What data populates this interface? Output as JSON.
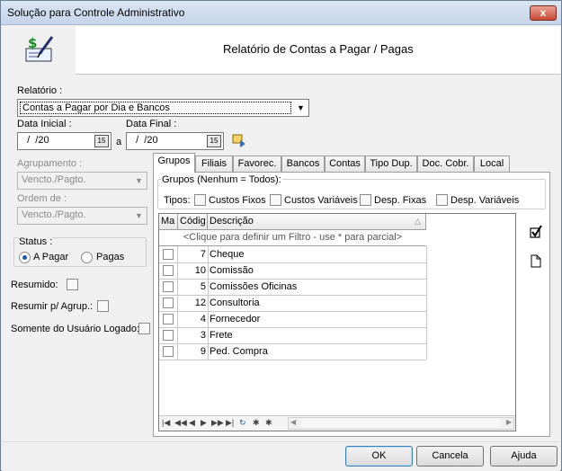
{
  "window": {
    "title": "Solução para Controle Administrativo",
    "close_glyph": "x"
  },
  "header": {
    "title": "Relatório de Contas a Pagar / Pagas",
    "icon": "money-pen-icon"
  },
  "form": {
    "relatorio_label": "Relatório :",
    "relatorio_value": "Contas a Pagar por Dia e Bancos",
    "data_inicial_label": "Data Inicial :",
    "data_inicial_value": "  /  /20",
    "a_label": "a",
    "data_final_label": "Data Final :",
    "data_final_value": "  /  /20",
    "agrupamento_label": "Agrupamento :",
    "agrupamento_value": "Vencto./Pagto.",
    "ordem_label": "Ordem de :",
    "ordem_value": "Vencto./Pagto.",
    "status_label": "Status :",
    "status_options": [
      "A Pagar",
      "Pagas"
    ],
    "status_selected": "A Pagar",
    "resumido_label": "Resumido:",
    "resumir_label": "Resumir p/ Agrup.:",
    "somente_label": "Somente do Usuário Logado:"
  },
  "tabs": [
    "Grupos",
    "Filiais",
    "Favorec.",
    "Bancos",
    "Contas",
    "Tipo Dup.",
    "Doc. Cobr.",
    "Local"
  ],
  "active_tab": "Grupos",
  "grupos": {
    "legend": "Grupos (Nenhum = Todos):",
    "tipos_label": "Tipos:",
    "tipos": [
      "Custos Fixos",
      "Custos Variáveis",
      "Desp. Fixas",
      "Desp. Variáveis"
    ]
  },
  "grid": {
    "columns": [
      "Ma",
      "Códig",
      "Descrição"
    ],
    "filter_hint": "<Clique para definir um Filtro - use * para parcial>",
    "rows": [
      {
        "code": "7",
        "desc": "Cheque"
      },
      {
        "code": "10",
        "desc": "Comissão"
      },
      {
        "code": "5",
        "desc": "Comissões Oficinas"
      },
      {
        "code": "12",
        "desc": "Consultoria"
      },
      {
        "code": "4",
        "desc": "Fornecedor"
      },
      {
        "code": "3",
        "desc": "Frete"
      },
      {
        "code": "9",
        "desc": "Ped. Compra"
      }
    ]
  },
  "buttons": {
    "ok": "OK",
    "cancel": "Cancela",
    "help": "Ajuda"
  }
}
